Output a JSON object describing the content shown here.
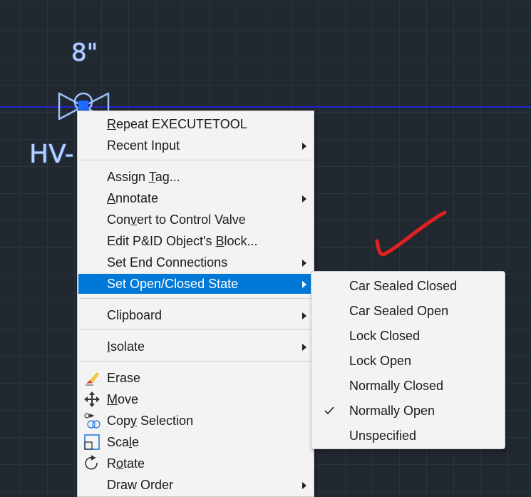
{
  "canvas": {
    "pipe_size": "8\"",
    "tag_label": "HV-"
  },
  "context_menu": {
    "items": [
      {
        "pre": "",
        "ul": "R",
        "post": "epeat EXECUTETOOL",
        "submenu": false
      },
      {
        "pre": "Recent Input",
        "ul": "",
        "post": "",
        "submenu": true
      },
      {
        "pre": "Assign ",
        "ul": "T",
        "post": "ag...",
        "submenu": false
      },
      {
        "pre": "",
        "ul": "A",
        "post": "nnotate",
        "submenu": true
      },
      {
        "pre": "Con",
        "ul": "v",
        "post": "ert to Control Valve",
        "submenu": false
      },
      {
        "pre": "Edit P&ID Object's ",
        "ul": "B",
        "post": "lock...",
        "submenu": false
      },
      {
        "pre": "Set End Connections",
        "ul": "",
        "post": "",
        "submenu": true
      },
      {
        "pre": "Set Open/Closed State",
        "ul": "",
        "post": "",
        "submenu": true
      },
      {
        "pre": "Clipboard",
        "ul": "",
        "post": "",
        "submenu": true
      },
      {
        "pre": "",
        "ul": "I",
        "post": "solate",
        "submenu": true
      },
      {
        "pre": "Erase",
        "ul": "",
        "post": "",
        "submenu": false
      },
      {
        "pre": "",
        "ul": "M",
        "post": "ove",
        "submenu": false
      },
      {
        "pre": "Cop",
        "ul": "y",
        "post": " Selection",
        "submenu": false
      },
      {
        "pre": "Sca",
        "ul": "l",
        "post": "e",
        "submenu": false
      },
      {
        "pre": "R",
        "ul": "o",
        "post": "tate",
        "submenu": false
      },
      {
        "pre": "Draw Or",
        "ul": "",
        "post": "der",
        "submenu": true
      }
    ],
    "highlighted_index": 7
  },
  "submenu": {
    "items": [
      "Car Sealed Closed",
      "Car Sealed Open",
      "Lock Closed",
      "Lock Open",
      "Normally Closed",
      "Normally Open",
      "Unspecified"
    ],
    "checked_index": 5
  },
  "icons": {
    "erase": "eraser-icon",
    "move": "move-arrows-icon",
    "copy": "copy-selection-icon",
    "scale": "scale-icon",
    "rotate": "rotate-icon",
    "check": "checkmark-icon"
  },
  "colors": {
    "canvas_bg": "#212830",
    "highlight": "#0078d7",
    "pipe_line": "#2323ff",
    "annotation_check": "#e32020",
    "cad_text": "#b9d3ff"
  }
}
